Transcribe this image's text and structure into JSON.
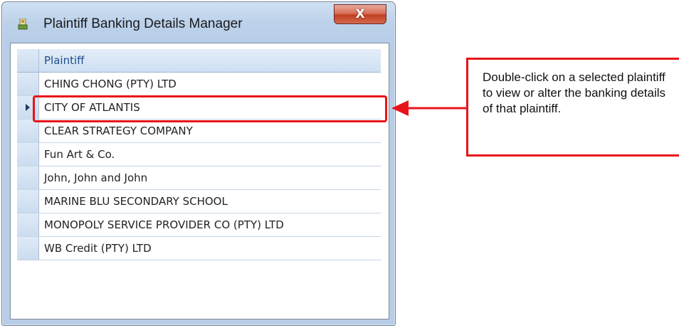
{
  "window": {
    "title": "Plaintiff Banking Details Manager",
    "close_label": "X"
  },
  "grid": {
    "column_header": "Plaintiff",
    "selected_index": 1,
    "rows": [
      "CHING CHONG  (PTY) LTD",
      "CITY OF ATLANTIS",
      "CLEAR STRATEGY COMPANY",
      "Fun Art & Co.",
      "John, John and John",
      "MARINE BLU SECONDARY SCHOOL",
      "MONOPOLY SERVICE PROVIDER CO (PTY) LTD",
      "WB Credit (PTY) LTD"
    ]
  },
  "callout": {
    "text": "Double-click on a selected plaintiff to view or alter the banking details of that plaintiff."
  },
  "colors": {
    "annotation_red": "#e8141a",
    "header_text": "#1f4d8c"
  },
  "icons": [
    "app-icon",
    "close-icon",
    "row-selector-arrow-icon"
  ]
}
